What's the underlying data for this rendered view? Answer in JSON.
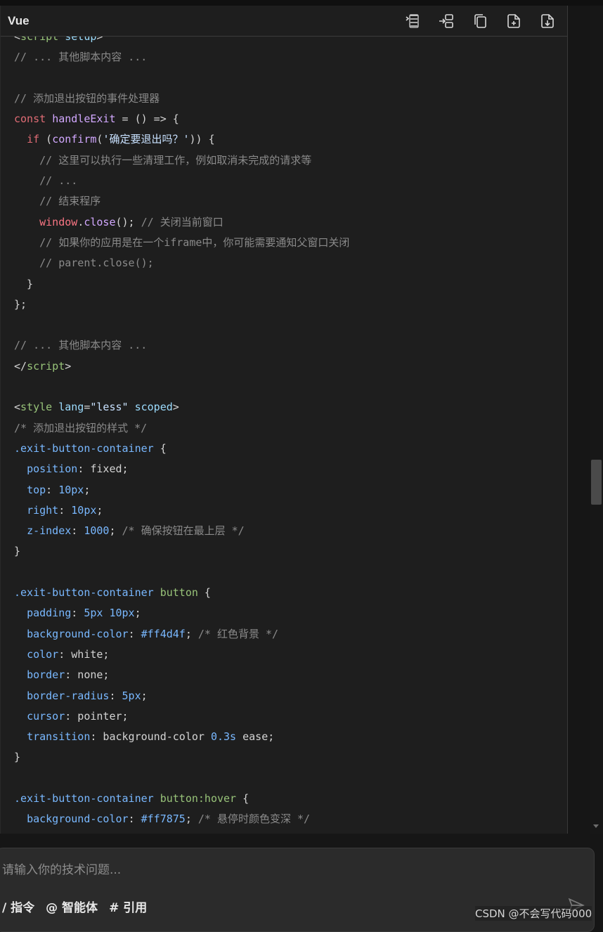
{
  "code_block": {
    "language": "Vue",
    "toolbar": [
      {
        "name": "insert-code-icon"
      },
      {
        "name": "insert-to-terminal-icon"
      },
      {
        "name": "copy-icon"
      },
      {
        "name": "new-file-icon"
      },
      {
        "name": "save-file-icon"
      }
    ],
    "lines": [
      [
        {
          "t": "<",
          "c": "pun"
        },
        {
          "t": "script",
          "c": "tag"
        },
        {
          "t": " setup",
          "c": "attr"
        },
        {
          "t": ">",
          "c": "pun"
        }
      ],
      [
        {
          "t": "// ... 其他脚本内容 ...",
          "c": "cm"
        }
      ],
      [],
      [
        {
          "t": "// 添加退出按钮的事件处理器",
          "c": "cm"
        }
      ],
      [
        {
          "t": "const",
          "c": "kw"
        },
        {
          "t": " ",
          "c": "pun"
        },
        {
          "t": "handleExit",
          "c": "fn"
        },
        {
          "t": " = () => {",
          "c": "pun"
        }
      ],
      [
        {
          "t": "  ",
          "c": "pun"
        },
        {
          "t": "if",
          "c": "kw"
        },
        {
          "t": " (",
          "c": "pun"
        },
        {
          "t": "confirm",
          "c": "fn"
        },
        {
          "t": "(",
          "c": "pun"
        },
        {
          "t": "'确定要退出吗？'",
          "c": "str"
        },
        {
          "t": ")) {",
          "c": "pun"
        }
      ],
      [
        {
          "t": "    // 这里可以执行一些清理工作，例如取消未完成的请求等",
          "c": "cm"
        }
      ],
      [
        {
          "t": "    // ...",
          "c": "cm"
        }
      ],
      [
        {
          "t": "    // 结束程序",
          "c": "cm"
        }
      ],
      [
        {
          "t": "    ",
          "c": "pun"
        },
        {
          "t": "window",
          "c": "obj"
        },
        {
          "t": ".",
          "c": "pun"
        },
        {
          "t": "close",
          "c": "fn"
        },
        {
          "t": "(); ",
          "c": "pun"
        },
        {
          "t": "// 关闭当前窗口",
          "c": "cm"
        }
      ],
      [
        {
          "t": "    // 如果你的应用是在一个iframe中，你可能需要通知父窗口关闭",
          "c": "cm"
        }
      ],
      [
        {
          "t": "    // parent.close();",
          "c": "cm"
        }
      ],
      [
        {
          "t": "  }",
          "c": "pun"
        }
      ],
      [
        {
          "t": "};",
          "c": "pun"
        }
      ],
      [],
      [
        {
          "t": "// ... 其他脚本内容 ...",
          "c": "cm"
        }
      ],
      [
        {
          "t": "</",
          "c": "pun"
        },
        {
          "t": "script",
          "c": "tag"
        },
        {
          "t": ">",
          "c": "pun"
        }
      ],
      [],
      [
        {
          "t": "<",
          "c": "pun"
        },
        {
          "t": "style",
          "c": "tag"
        },
        {
          "t": " lang",
          "c": "attr"
        },
        {
          "t": "=",
          "c": "pun"
        },
        {
          "t": "\"less\"",
          "c": "str"
        },
        {
          "t": " scoped",
          "c": "attr"
        },
        {
          "t": ">",
          "c": "pun"
        }
      ],
      [
        {
          "t": "/* 添加退出按钮的样式 */",
          "c": "cm"
        }
      ],
      [
        {
          "t": ".exit-button-container",
          "c": "sel"
        },
        {
          "t": " {",
          "c": "pun"
        }
      ],
      [
        {
          "t": "  ",
          "c": "pun"
        },
        {
          "t": "position",
          "c": "prop"
        },
        {
          "t": ": fixed;",
          "c": "pun"
        }
      ],
      [
        {
          "t": "  ",
          "c": "pun"
        },
        {
          "t": "top",
          "c": "prop"
        },
        {
          "t": ": ",
          "c": "pun"
        },
        {
          "t": "10px",
          "c": "num"
        },
        {
          "t": ";",
          "c": "pun"
        }
      ],
      [
        {
          "t": "  ",
          "c": "pun"
        },
        {
          "t": "right",
          "c": "prop"
        },
        {
          "t": ": ",
          "c": "pun"
        },
        {
          "t": "10px",
          "c": "num"
        },
        {
          "t": ";",
          "c": "pun"
        }
      ],
      [
        {
          "t": "  ",
          "c": "pun"
        },
        {
          "t": "z-index",
          "c": "prop"
        },
        {
          "t": ": ",
          "c": "pun"
        },
        {
          "t": "1000",
          "c": "num"
        },
        {
          "t": "; ",
          "c": "pun"
        },
        {
          "t": "/* 确保按钮在最上层 */",
          "c": "cm"
        }
      ],
      [
        {
          "t": "}",
          "c": "pun"
        }
      ],
      [],
      [
        {
          "t": ".exit-button-container",
          "c": "sel"
        },
        {
          "t": " button",
          "c": "tag"
        },
        {
          "t": " {",
          "c": "pun"
        }
      ],
      [
        {
          "t": "  ",
          "c": "pun"
        },
        {
          "t": "padding",
          "c": "prop"
        },
        {
          "t": ": ",
          "c": "pun"
        },
        {
          "t": "5px 10px",
          "c": "num"
        },
        {
          "t": ";",
          "c": "pun"
        }
      ],
      [
        {
          "t": "  ",
          "c": "pun"
        },
        {
          "t": "background-color",
          "c": "prop"
        },
        {
          "t": ": ",
          "c": "pun"
        },
        {
          "t": "#ff4d4f",
          "c": "num"
        },
        {
          "t": "; ",
          "c": "pun"
        },
        {
          "t": "/* 红色背景 */",
          "c": "cm"
        }
      ],
      [
        {
          "t": "  ",
          "c": "pun"
        },
        {
          "t": "color",
          "c": "prop"
        },
        {
          "t": ": white;",
          "c": "pun"
        }
      ],
      [
        {
          "t": "  ",
          "c": "pun"
        },
        {
          "t": "border",
          "c": "prop"
        },
        {
          "t": ": none;",
          "c": "pun"
        }
      ],
      [
        {
          "t": "  ",
          "c": "pun"
        },
        {
          "t": "border-radius",
          "c": "prop"
        },
        {
          "t": ": ",
          "c": "pun"
        },
        {
          "t": "5px",
          "c": "num"
        },
        {
          "t": ";",
          "c": "pun"
        }
      ],
      [
        {
          "t": "  ",
          "c": "pun"
        },
        {
          "t": "cursor",
          "c": "prop"
        },
        {
          "t": ": pointer;",
          "c": "pun"
        }
      ],
      [
        {
          "t": "  ",
          "c": "pun"
        },
        {
          "t": "transition",
          "c": "prop"
        },
        {
          "t": ": background-color ",
          "c": "pun"
        },
        {
          "t": "0.3s",
          "c": "num"
        },
        {
          "t": " ease;",
          "c": "pun"
        }
      ],
      [
        {
          "t": "}",
          "c": "pun"
        }
      ],
      [],
      [
        {
          "t": ".exit-button-container",
          "c": "sel"
        },
        {
          "t": " button:hover",
          "c": "tag"
        },
        {
          "t": " {",
          "c": "pun"
        }
      ],
      [
        {
          "t": "  ",
          "c": "pun"
        },
        {
          "t": "background-color",
          "c": "prop"
        },
        {
          "t": ": ",
          "c": "pun"
        },
        {
          "t": "#ff7875",
          "c": "num"
        },
        {
          "t": "; ",
          "c": "pun"
        },
        {
          "t": "/* 悬停时颜色变深 */",
          "c": "cm"
        }
      ],
      [
        {
          "t": "}",
          "c": "pun"
        }
      ]
    ]
  },
  "chat_input": {
    "placeholder": "请输入你的技术问题...",
    "actions": [
      {
        "label": "/ 指令"
      },
      {
        "label": "@ 智能体"
      },
      {
        "label": "# 引用"
      }
    ]
  },
  "watermark": "CSDN @不会写代码000",
  "colors": {
    "panel_bg": "#1e1e1e",
    "comment": "#8a8a8a",
    "keyword": "#e06c75",
    "tag": "#98c379",
    "property": "#79b8ff"
  }
}
